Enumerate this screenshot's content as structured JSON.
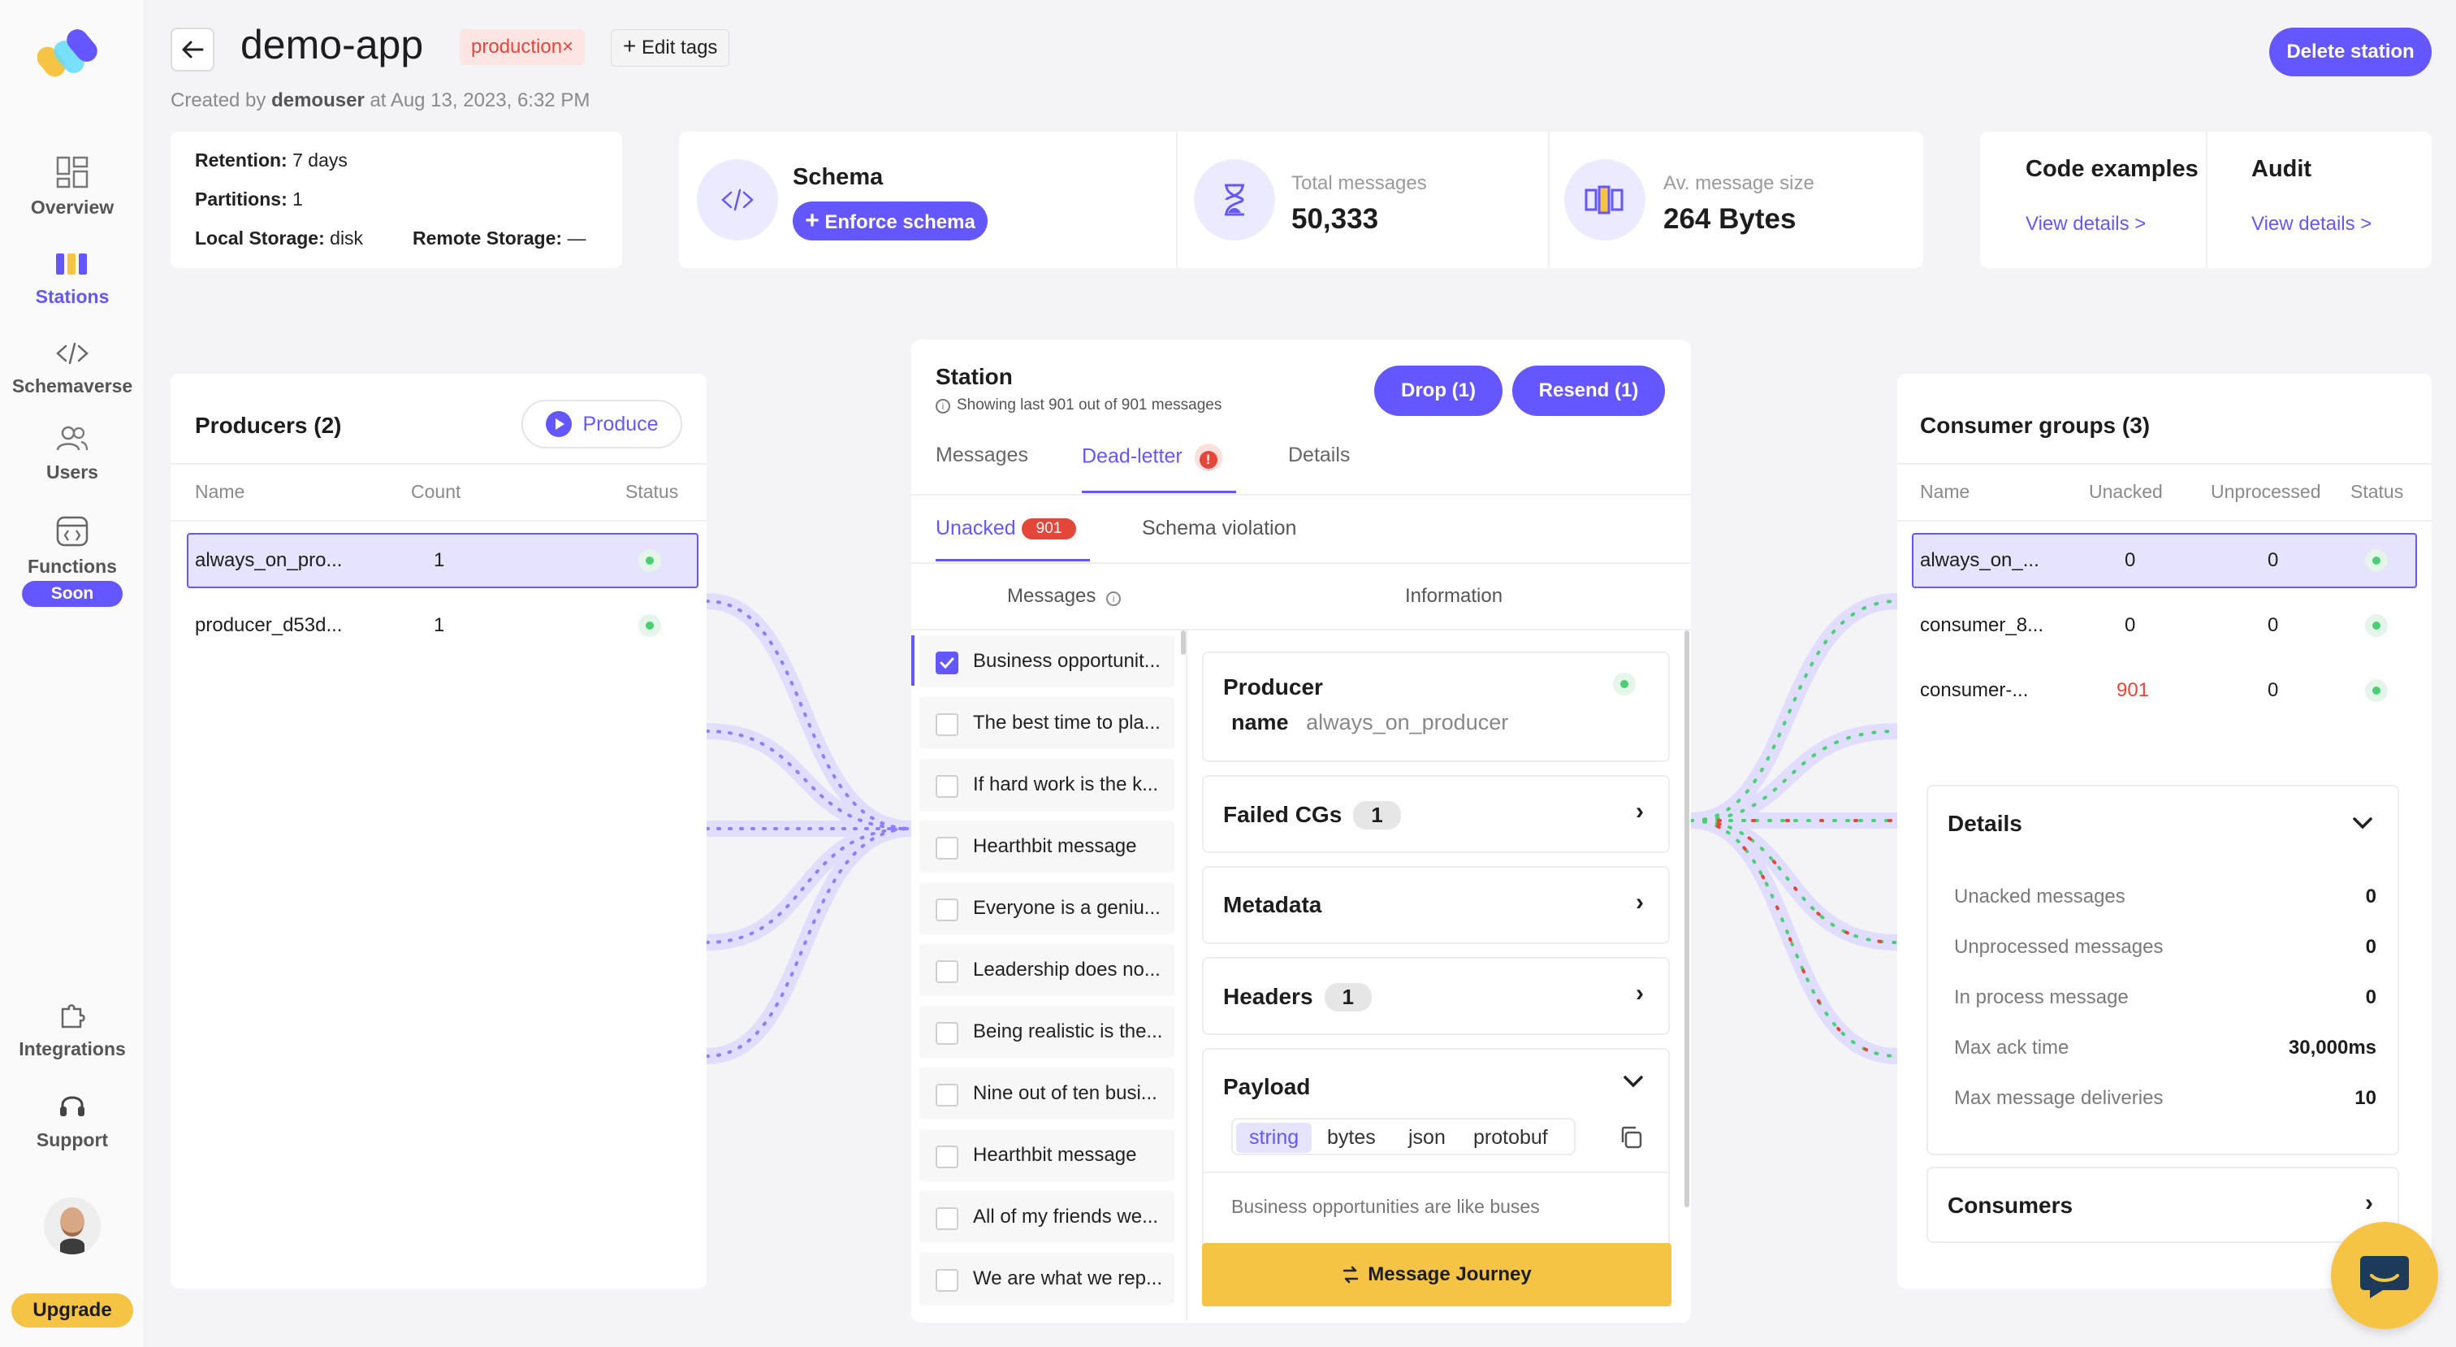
{
  "sidebar": {
    "items": [
      {
        "label": "Overview",
        "icon": "overview-icon"
      },
      {
        "label": "Stations",
        "icon": "stations-icon"
      },
      {
        "label": "Schemaverse",
        "icon": "code-icon"
      },
      {
        "label": "Users",
        "icon": "users-icon"
      },
      {
        "label": "Functions",
        "icon": "functions-icon",
        "badge": "Soon"
      },
      {
        "label": "Integrations",
        "icon": "puzzle-icon"
      },
      {
        "label": "Support",
        "icon": "headset-icon"
      }
    ],
    "upgrade_label": "Upgrade"
  },
  "header": {
    "title": "demo-app",
    "tag": "production",
    "tag_remove": "×",
    "edit_tags": "Edit tags",
    "created_prefix": "Created by",
    "created_user": "demouser",
    "created_suffix": "at Aug 13, 2023, 6:32 PM",
    "delete_label": "Delete station"
  },
  "info": {
    "retention_label": "Retention:",
    "retention_value": "7 days",
    "partitions_label": "Partitions:",
    "partitions_value": "1",
    "local_label": "Local Storage:",
    "local_value": "disk",
    "remote_label": "Remote Storage:",
    "remote_value": "—"
  },
  "schema": {
    "title": "Schema",
    "enforce_label": "Enforce schema"
  },
  "stats": {
    "total_label": "Total messages",
    "total_value": "50,333",
    "size_label": "Av. message size",
    "size_value": "264 Bytes"
  },
  "links": {
    "code_title": "Code examples",
    "code_link": "View details >",
    "audit_title": "Audit",
    "audit_link": "View details >"
  },
  "producers": {
    "title": "Producers (2)",
    "produce_label": "Produce",
    "headers": [
      "Name",
      "Count",
      "Status"
    ],
    "rows": [
      {
        "name": "always_on_pro...",
        "count": "1"
      },
      {
        "name": "producer_d53d...",
        "count": "1"
      }
    ]
  },
  "station": {
    "title": "Station",
    "subtitle": "Showing last 901 out of 901 messages",
    "drop_label": "Drop (1)",
    "resend_label": "Resend (1)",
    "tabs": [
      "Messages",
      "Dead-letter",
      "Details"
    ],
    "subtabs": {
      "unacked": "Unacked",
      "unacked_count": "901",
      "schema": "Schema violation"
    },
    "col_messages": "Messages",
    "col_information": "Information",
    "messages": [
      "Business opportunit...",
      "The best time to pla...",
      "If hard work is the k...",
      "Hearthbit message",
      "Everyone is a geniu...",
      "Leadership does no...",
      "Being realistic is the...",
      "Nine out of ten busi...",
      "Hearthbit message",
      "All of my friends we...",
      "We are what we rep..."
    ],
    "producer_title": "Producer",
    "producer_name_label": "name",
    "producer_name_value": "always_on_producer",
    "failed_cgs": "Failed CGs",
    "failed_cgs_count": "1",
    "metadata": "Metadata",
    "headers_label": "Headers",
    "headers_count": "1",
    "payload": "Payload",
    "formats": [
      "string",
      "bytes",
      "json",
      "protobuf"
    ],
    "payload_text": "Business opportunities are like buses",
    "journey_label": "Message Journey"
  },
  "consumers": {
    "title": "Consumer groups (3)",
    "headers": [
      "Name",
      "Unacked",
      "Unprocessed",
      "Status"
    ],
    "rows": [
      {
        "name": "always_on_...",
        "unacked": "0",
        "unprocessed": "0"
      },
      {
        "name": "consumer_8...",
        "unacked": "0",
        "unprocessed": "0"
      },
      {
        "name": "consumer-...",
        "unacked": "901",
        "unprocessed": "0"
      }
    ],
    "details_title": "Details",
    "details": [
      {
        "label": "Unacked messages",
        "value": "0"
      },
      {
        "label": "Unprocessed messages",
        "value": "0"
      },
      {
        "label": "In process message",
        "value": "0"
      },
      {
        "label": "Max ack time",
        "value": "30,000ms"
      },
      {
        "label": "Max message deliveries",
        "value": "10"
      }
    ],
    "consumers_label": "Consumers"
  },
  "colors": {
    "accent": "#6557ff",
    "danger": "#e4463a",
    "warning": "#f5c445",
    "success": "#4bcf75"
  }
}
